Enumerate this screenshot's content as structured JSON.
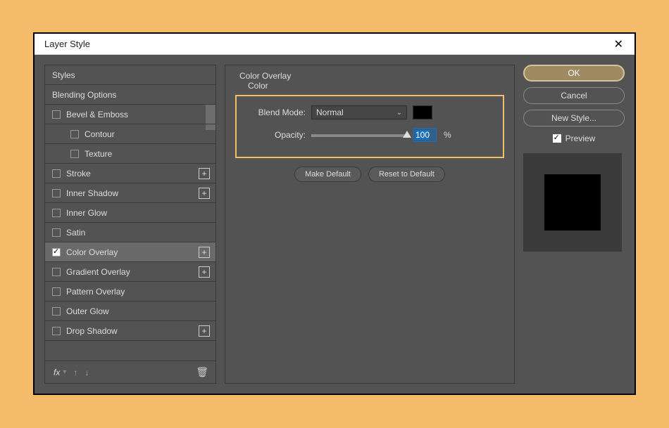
{
  "dialog": {
    "title": "Layer Style"
  },
  "sidebar": {
    "styles_label": "Styles",
    "blending_options_label": "Blending Options",
    "items": [
      {
        "label": "Bevel & Emboss",
        "checked": false,
        "plus": false
      },
      {
        "label": "Contour",
        "checked": false,
        "indent": true
      },
      {
        "label": "Texture",
        "checked": false,
        "indent": true
      },
      {
        "label": "Stroke",
        "checked": false,
        "plus": true
      },
      {
        "label": "Inner Shadow",
        "checked": false,
        "plus": true
      },
      {
        "label": "Inner Glow",
        "checked": false
      },
      {
        "label": "Satin",
        "checked": false
      },
      {
        "label": "Color Overlay",
        "checked": true,
        "plus": true,
        "selected": true
      },
      {
        "label": "Gradient Overlay",
        "checked": false,
        "plus": true
      },
      {
        "label": "Pattern Overlay",
        "checked": false
      },
      {
        "label": "Outer Glow",
        "checked": false
      },
      {
        "label": "Drop Shadow",
        "checked": false,
        "plus": true
      }
    ],
    "fx_label": "fx"
  },
  "main": {
    "section_title": "Color Overlay",
    "subsection_title": "Color",
    "blend_mode_label": "Blend Mode:",
    "blend_mode_value": "Normal",
    "color_swatch": "#000000",
    "opacity_label": "Opacity:",
    "opacity_value": "100",
    "opacity_unit": "%",
    "make_default_label": "Make Default",
    "reset_default_label": "Reset to Default"
  },
  "actions": {
    "ok": "OK",
    "cancel": "Cancel",
    "new_style": "New Style...",
    "preview": "Preview"
  }
}
